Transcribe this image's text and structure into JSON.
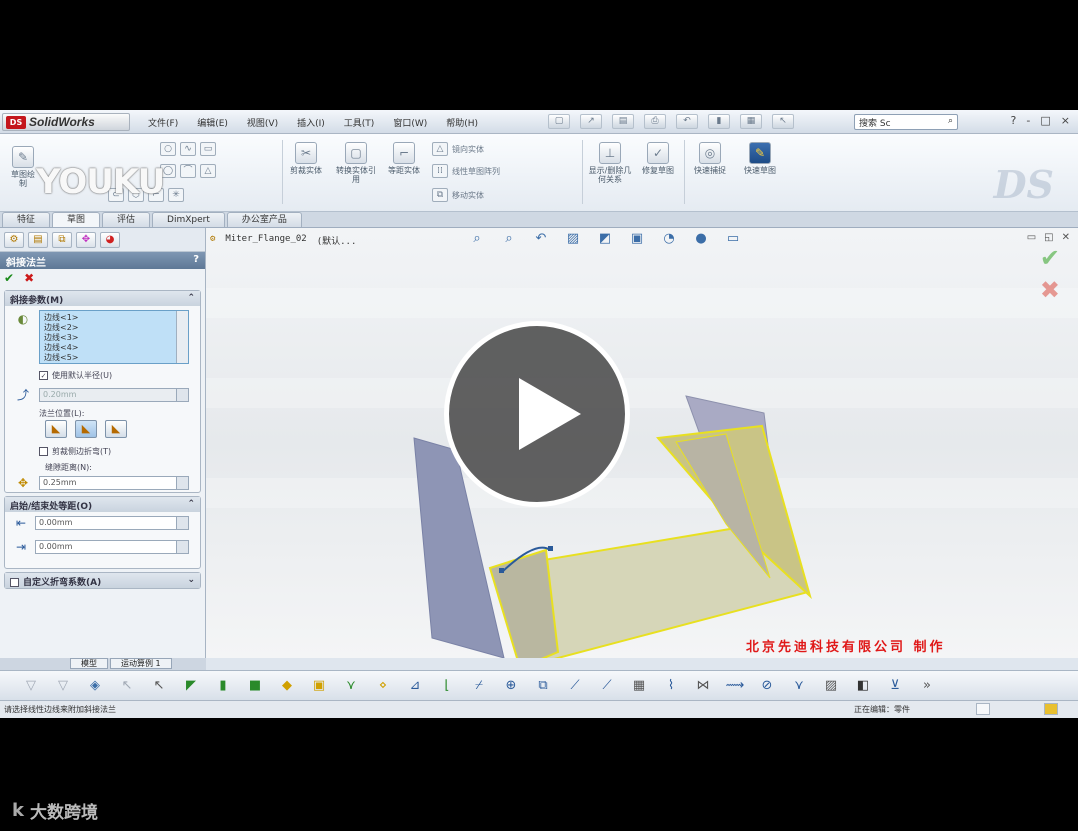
{
  "app": {
    "name": "SolidWorks",
    "logo_mark": "DS",
    "menus": [
      "文件(F)",
      "编辑(E)",
      "视图(V)",
      "插入(I)",
      "工具(T)",
      "窗口(W)",
      "帮助(H)"
    ],
    "search_placeholder": "搜索 Sc",
    "window_controls": [
      "?",
      "-",
      "□",
      "×"
    ]
  },
  "watermark": {
    "youku": "YOUKU",
    "ds": "DS"
  },
  "ribbon": {
    "large_buttons": [
      "草图绘制",
      "剪裁实体",
      "转换实体引用",
      "等距实体",
      "显示/删除几何关系",
      "修复草图",
      "快速捕捉",
      "快速草图"
    ],
    "list_items": [
      "镜向实体",
      "线性草图阵列",
      "移动实体"
    ]
  },
  "tabs": [
    "特征",
    "草图",
    "评估",
    "DimXpert",
    "办公室产品"
  ],
  "active_tab": "草图",
  "property_manager": {
    "title": "斜接法兰",
    "help": "?",
    "miter_group": {
      "title": "斜接参数(M)",
      "edges": [
        "边线<1>",
        "边线<2>",
        "边线<3>",
        "边线<4>",
        "边线<5>"
      ],
      "use_default_radius": "使用默认半径(U)",
      "radius_value": "0.20mm",
      "flange_position": "法兰位置(L):",
      "trim_side_bends": "剪裁侧边折弯(T)",
      "gap_distance_label": "缝隙距离(N):",
      "gap_distance_value": "0.25mm"
    },
    "offset_group": {
      "title": "启始/结束处等距(O)",
      "start_value": "0.00mm",
      "end_value": "0.00mm"
    },
    "custom_group": {
      "title": "自定义折弯系数(A)"
    }
  },
  "graphics": {
    "breadcrumb_part": "Miter_Flange_02",
    "breadcrumb_config": "(默认...",
    "company_credit": "北京先迪科技有限公司    制作"
  },
  "bottom_tabs": [
    "模型",
    "运动算例 1"
  ],
  "status": {
    "message": "请选择线性边线来附加斜接法兰",
    "editing": "正在编辑：零件"
  },
  "video": {
    "brand": "大数跨境",
    "brand_mark": "k"
  },
  "colors": {
    "accent": "#c4161c",
    "highlight": "#e8e020",
    "credit": "#e01818"
  }
}
